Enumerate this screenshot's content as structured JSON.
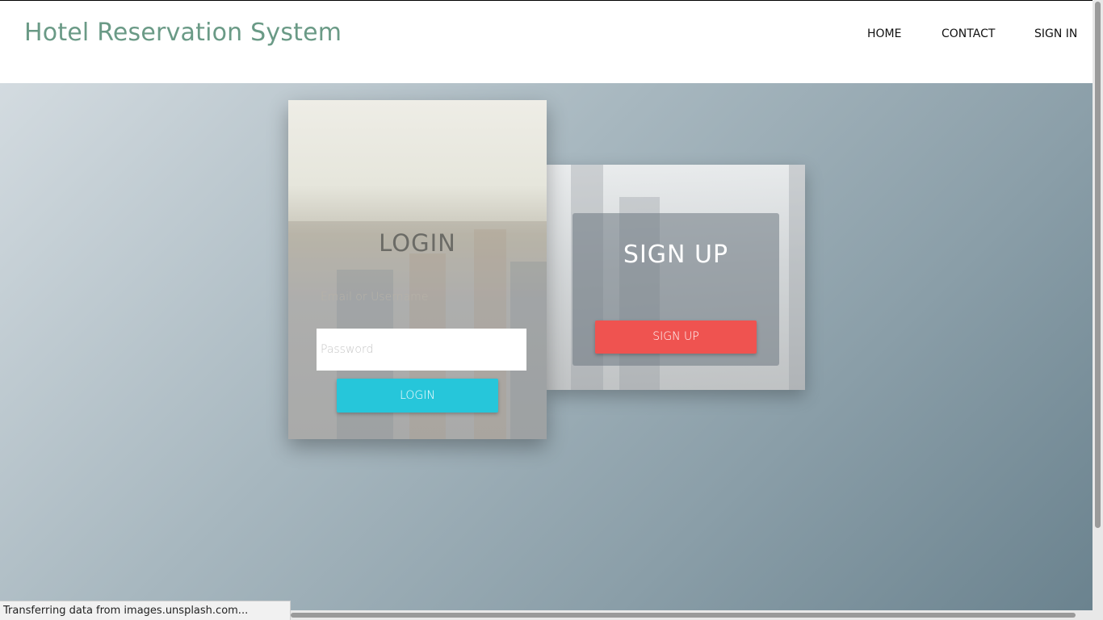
{
  "header": {
    "brand": "Hotel Reservation System",
    "nav": {
      "home": "HOME",
      "contact": "CONTACT",
      "sign_in": "SIGN IN"
    }
  },
  "login": {
    "title": "LOGIN",
    "username_placeholder": "Email or Username",
    "password_placeholder": "Password",
    "button": "LOGIN"
  },
  "signup": {
    "title": "SIGN UP",
    "button": "SIGN UP"
  },
  "status_bar": {
    "text": "Transferring data from images.unsplash.com..."
  },
  "colors": {
    "brand": "#6a9a86",
    "login_button": "#26c6da",
    "signup_button": "#ef5350"
  }
}
